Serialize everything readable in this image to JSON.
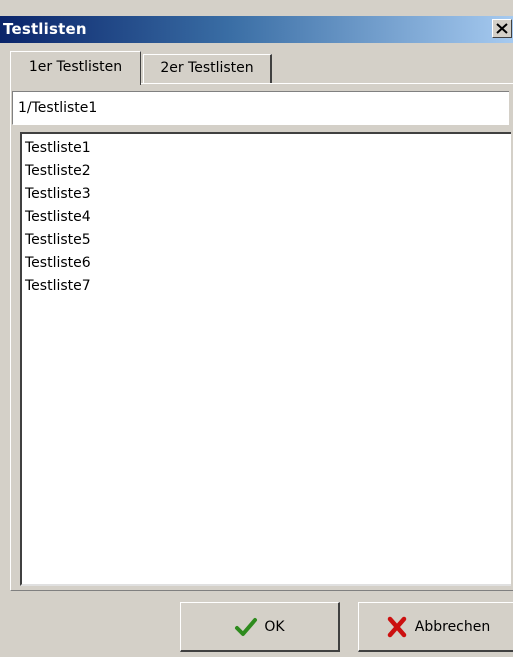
{
  "window": {
    "title": "Testlisten",
    "close_glyph": "✕"
  },
  "tabs": [
    {
      "label": "1er Testlisten",
      "active": true
    },
    {
      "label": "2er Testlisten",
      "active": false
    }
  ],
  "path_field": {
    "value": "1/Testliste1"
  },
  "list": {
    "items": [
      "Testliste1",
      "Testliste2",
      "Testliste3",
      "Testliste4",
      "Testliste5",
      "Testliste6",
      "Testliste7"
    ]
  },
  "buttons": {
    "ok_label": "OK",
    "ok_icon": "checkmark-icon",
    "ok_icon_color": "#2e8b1e",
    "cancel_label": "Abbrechen",
    "cancel_icon": "x-cross-icon",
    "cancel_icon_color": "#cc1010"
  },
  "colors": {
    "titlebar_start": "#0a246a",
    "titlebar_end": "#a6caf0",
    "window_face": "#d4d0c8"
  }
}
